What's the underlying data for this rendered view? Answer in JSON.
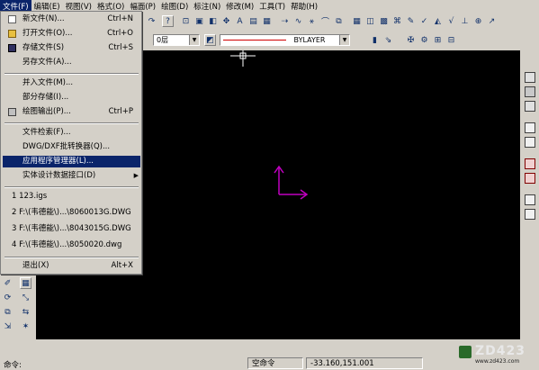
{
  "menubar": {
    "items": [
      {
        "label": "文件(F)",
        "active": true
      },
      {
        "label": "编辑(E)"
      },
      {
        "label": "视图(V)"
      },
      {
        "label": "格式(O)"
      },
      {
        "label": "幅面(P)"
      },
      {
        "label": "绘图(D)"
      },
      {
        "label": "标注(N)"
      },
      {
        "label": "修改(M)"
      },
      {
        "label": "工具(T)"
      },
      {
        "label": "帮助(H)"
      }
    ]
  },
  "layer_combo": {
    "value": "0层"
  },
  "linetype_combo": {
    "value": "BYLAYER"
  },
  "file_menu": {
    "items": [
      {
        "label": "新文件(N)...",
        "shortcut": "Ctrl+N",
        "icon": "new-file-icon"
      },
      {
        "label": "打开文件(O)...",
        "shortcut": "Ctrl+O",
        "icon": "open-folder-icon"
      },
      {
        "label": "存储文件(S)",
        "shortcut": "Ctrl+S",
        "icon": "save-disk-icon"
      },
      {
        "label": "另存文件(A)...",
        "shortcut": ""
      },
      {
        "label": "并入文件(M)...",
        "shortcut": ""
      },
      {
        "label": "部分存储(I)...",
        "shortcut": ""
      },
      {
        "label": "绘图输出(P)...",
        "shortcut": "Ctrl+P",
        "icon": "printer-icon"
      },
      {
        "label": "文件检索(F)...",
        "shortcut": ""
      },
      {
        "label": "DWG/DXF批转换器(Q)...",
        "shortcut": ""
      },
      {
        "label": "应用程序管理器(L)...",
        "shortcut": "",
        "highlighted": true
      },
      {
        "label": "实体设计数据接口(D)",
        "shortcut": "",
        "submenu": true
      },
      {
        "label": "1 123.igs",
        "shortcut": ""
      },
      {
        "label": "2 F:\\(韦德能\\)...\\8060013G.DWG",
        "shortcut": ""
      },
      {
        "label": "3 F:\\(韦德能\\)...\\8043015G.DWG",
        "shortcut": ""
      },
      {
        "label": "4 F:\\(韦德能\\)...\\8050020.dwg",
        "shortcut": ""
      },
      {
        "label": "退出(X)",
        "shortcut": "Alt+X"
      }
    ]
  },
  "statusbar": {
    "command_label": "命令:",
    "mode": "空命令",
    "coordinates": "-33.160,151.001"
  },
  "watermark": {
    "text": "ZD423",
    "sub": "www.zd423.com"
  },
  "colors": {
    "menu_highlight": "#0a246a",
    "canvas": "#000000",
    "axis": "#c000c0",
    "linetype_red": "#d00000"
  }
}
